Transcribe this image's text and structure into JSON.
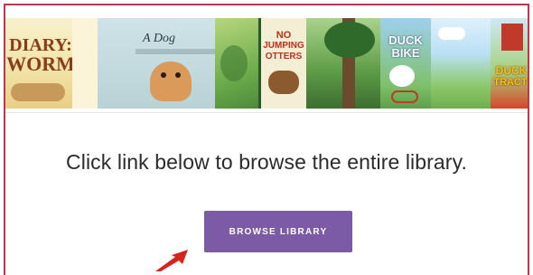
{
  "books": [
    {
      "name": "book-cover-diary-of-a-worm",
      "title_line1": "DIARY",
      "title_line2": "WORM"
    },
    {
      "name": "book-cover-a-dog",
      "title_line1": "A Dog"
    },
    {
      "name": "book-cover-green-illustration"
    },
    {
      "name": "book-cover-no-jumping-otters",
      "title_line1": "NO",
      "title_line2": "JUMPING",
      "title_line3": "OTTERS"
    },
    {
      "name": "book-cover-forest-illustration"
    },
    {
      "name": "book-cover-duck-bike",
      "title_line1": "DUCK",
      "title_line2": "BIKE"
    },
    {
      "name": "book-cover-meadow-illustration"
    },
    {
      "name": "book-cover-duck-tractor",
      "title_line1": "DUCK",
      "title_line2": "TRACT"
    }
  ],
  "main": {
    "headline": "Click link below to browse the entire library.",
    "browse_button_label": "BROWSE LIBRARY"
  },
  "colors": {
    "frame_border": "#b93a4a",
    "button_bg": "#7b5aa6",
    "arrow": "#d4241b"
  }
}
